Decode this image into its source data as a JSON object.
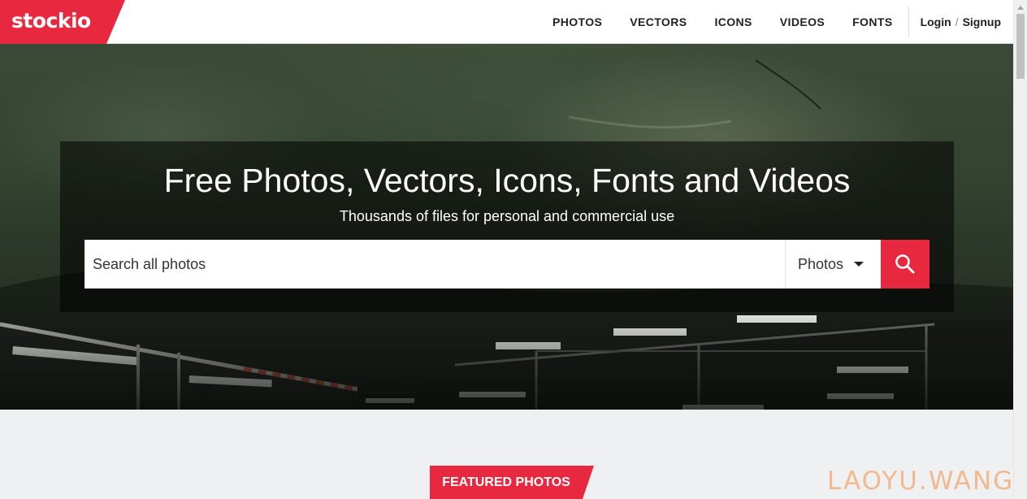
{
  "brand": {
    "name": "stockio",
    "color": "#e8283f"
  },
  "nav": {
    "items": [
      {
        "label": "PHOTOS"
      },
      {
        "label": "VECTORS"
      },
      {
        "label": "ICONS"
      },
      {
        "label": "VIDEOS"
      },
      {
        "label": "FONTS"
      }
    ],
    "login": "Login",
    "separator": "/",
    "signup": "Signup"
  },
  "hero": {
    "title": "Free Photos, Vectors, Icons, Fonts and Videos",
    "subtitle": "Thousands of files for personal and commercial use"
  },
  "search": {
    "placeholder": "Search all photos",
    "type_selected": "Photos",
    "button_icon": "search-icon"
  },
  "featured": {
    "label": "FEATURED PHOTOS"
  },
  "watermark": "LAOYU.WANG"
}
